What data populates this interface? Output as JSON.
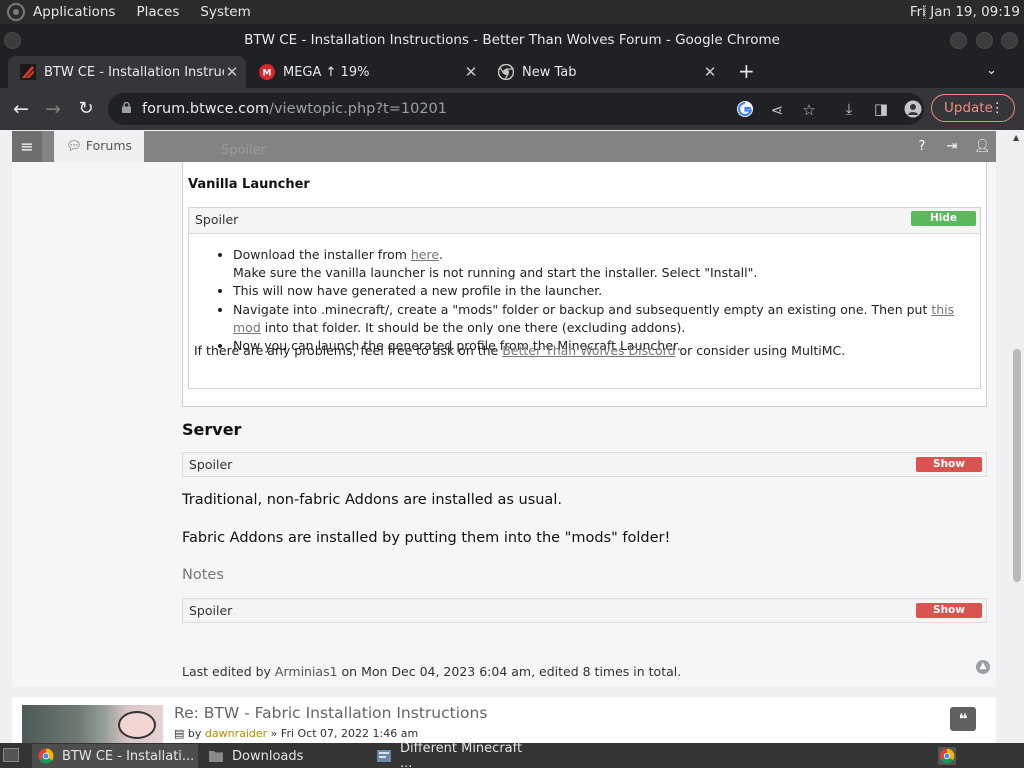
{
  "desktop": {
    "menus": [
      "Applications",
      "Places",
      "System"
    ],
    "clock": "Fri Jan 19, 09:19"
  },
  "window": {
    "title": "BTW CE - Installation Instructions - Better Than Wolves Forum - Google Chrome"
  },
  "tabs": [
    {
      "title": "BTW CE - Installation Instructions",
      "icon": "btw-favicon-icon"
    },
    {
      "title": "MEGA ↑ 19%",
      "icon": "mega-favicon-icon"
    },
    {
      "title": "New Tab",
      "icon": "chrome-favicon-icon"
    }
  ],
  "toolbar": {
    "url_host": "forum.btwce.com",
    "url_path": "/viewtopic.php?t=10201",
    "update_label": "Update"
  },
  "forum_nav": {
    "forums_label": "Forums",
    "ghost_text": "Spoiler"
  },
  "post": {
    "vanilla_heading": "Vanilla Launcher",
    "spoiler_label": "Spoiler",
    "hide_label": "Hide",
    "show_label": "Show",
    "list": {
      "download_prefix": "Download the installer from ",
      "here_link": "here",
      "download_suffix": ".",
      "launcher_note": "Make sure the vanilla launcher is not running and start the installer. Select \"Install\".",
      "profile_note": "This will now have generated a new profile in the launcher.",
      "navigate_prefix": "Navigate into .minecraft/, create a \"mods\" folder or backup and subsequently empty an existing one. Then put ",
      "mod_link": "this mod",
      "navigate_suffix": " into that folder. It should be the only one there (excluding addons).",
      "launch_note": "Now you can launch the generated profile from the Minecraft Launcher."
    },
    "problems_prefix": "If there are any problems, feel free to ask on the ",
    "discord_link": "Better Than Wolves Discord",
    "problems_suffix": " or consider using MultiMC.",
    "server_heading": "Server",
    "traditional": "Traditional, non-fabric Addons are installed as usual.",
    "fabric": "Fabric Addons are installed by putting them into the \"mods\" folder!",
    "notes_heading": "Notes",
    "edited_prefix": "Last edited by ",
    "edited_author": "Arminias1",
    "edited_suffix": " on Mon Dec 04, 2023 6:04 am, edited 8 times in total."
  },
  "reply": {
    "title": "Re: BTW - Fabric Installation Instructions",
    "by_prefix": "by ",
    "author": "dawnraider",
    "date": " » Fri Oct 07, 2022 1:46 am"
  },
  "taskbar": {
    "items": [
      "BTW CE - Installati...",
      "Downloads",
      "Different Minecraft ..."
    ]
  },
  "colors": {
    "hide_badge": "#5cb85c",
    "show_badge": "#d9534f",
    "update_accent": "#f28b82"
  }
}
